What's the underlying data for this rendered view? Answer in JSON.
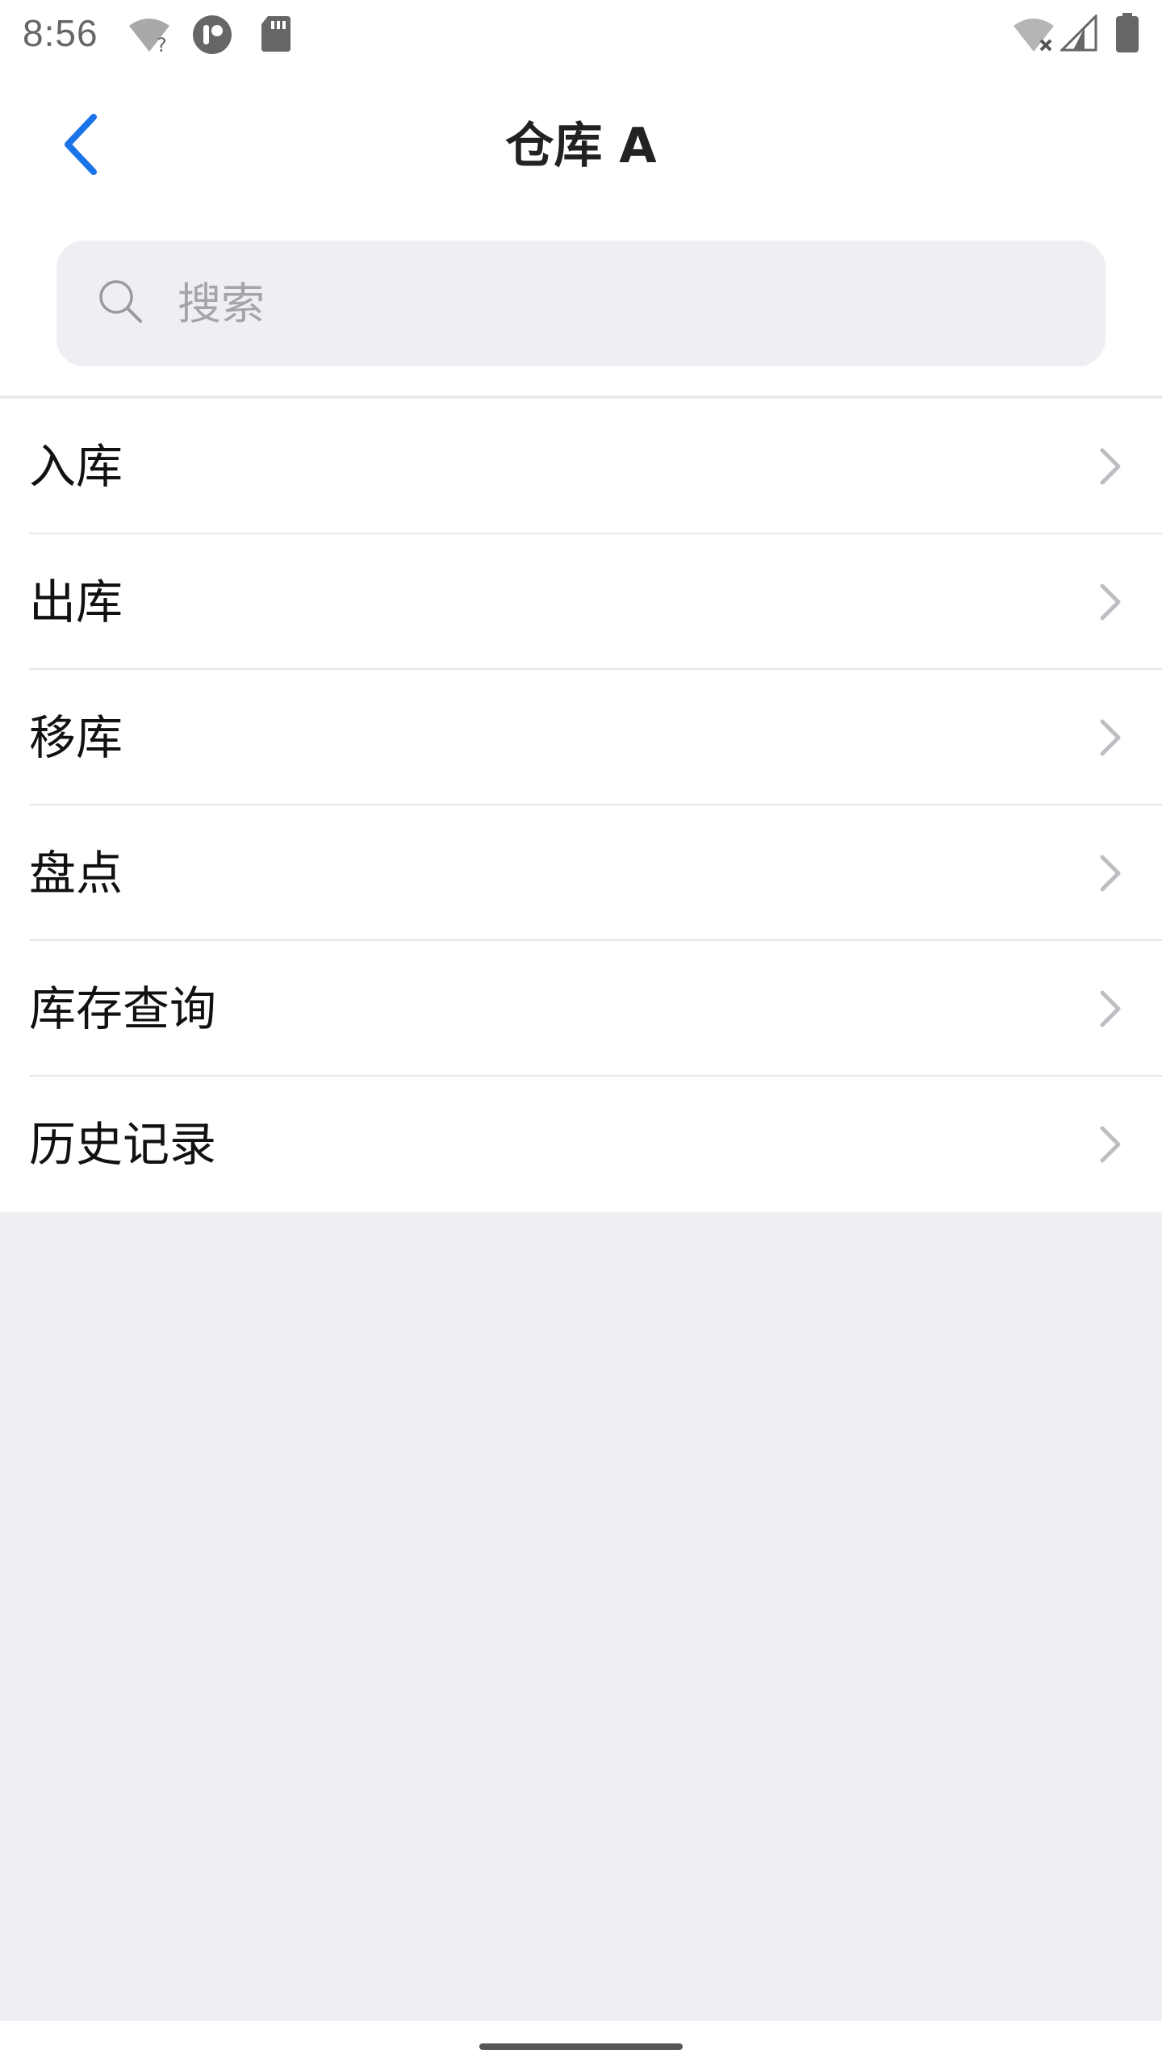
{
  "status_bar": {
    "time": "8:56",
    "icons": [
      "wifi-question-icon",
      "app-notification-icon",
      "sd-card-icon",
      "wifi-off-icon",
      "cellular-signal-icon",
      "battery-icon"
    ]
  },
  "header": {
    "title": "仓库 A",
    "back_icon": "chevron-left-icon",
    "accent_color": "#1a73e8"
  },
  "search": {
    "placeholder": "搜索",
    "value": ""
  },
  "menu": {
    "items": [
      {
        "label": "入库"
      },
      {
        "label": "出库"
      },
      {
        "label": "移库"
      },
      {
        "label": "盘点"
      },
      {
        "label": "库存查询"
      },
      {
        "label": "历史记录"
      }
    ]
  },
  "colors": {
    "background": "#efeef3",
    "surface": "#ffffff",
    "text_primary": "#111111",
    "chevron": "#bdbdc2"
  }
}
